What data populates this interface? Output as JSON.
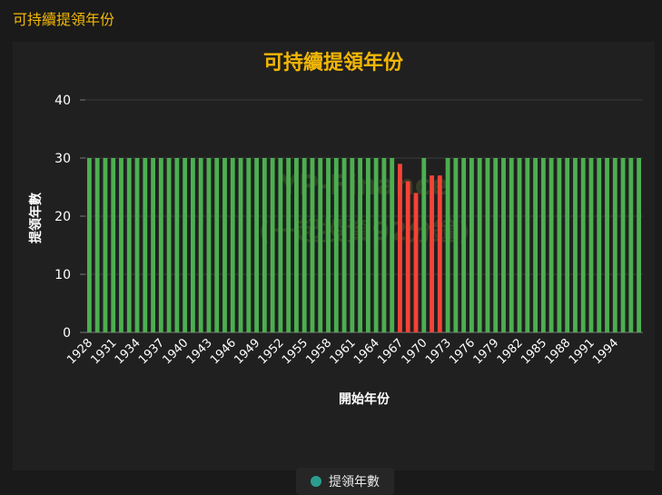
{
  "page": {
    "title": "可持續提領年份"
  },
  "chart_data": {
    "type": "bar",
    "title": "可持續提領年份",
    "xlabel": "開始年份",
    "ylabel": "提領年數",
    "ylim": [
      0,
      40
    ],
    "yticks": [
      0,
      10,
      20,
      30,
      40
    ],
    "grid": true,
    "legend_position": "bottom",
    "watermark": [
      "YP-Finance",
      "(一起投資92分鐘)"
    ],
    "x_start": 1928,
    "x_tick_labels": [
      "1928",
      "1931",
      "1934",
      "1937",
      "1940",
      "1943",
      "1946",
      "1949",
      "1952",
      "1955",
      "1958",
      "1961",
      "1964",
      "1967",
      "1970",
      "1973",
      "1976",
      "1979",
      "1982",
      "1985",
      "1988",
      "1991",
      "1994"
    ],
    "series": [
      {
        "name": "提領年數",
        "legend_color": "#2a9d8f",
        "bar_color": "#4caf50",
        "shortfall_color": "#f44336",
        "values": [
          30,
          30,
          30,
          30,
          30,
          30,
          30,
          30,
          30,
          30,
          30,
          30,
          30,
          30,
          30,
          30,
          30,
          30,
          30,
          30,
          30,
          30,
          30,
          30,
          30,
          30,
          30,
          30,
          30,
          30,
          30,
          30,
          30,
          30,
          30,
          30,
          30,
          30,
          30,
          29,
          26,
          24,
          30,
          27,
          27,
          30,
          30,
          30,
          30,
          30,
          30,
          30,
          30,
          30,
          30,
          30,
          30,
          30,
          30,
          30,
          30,
          30,
          30,
          30,
          30,
          30,
          30,
          30,
          30,
          30
        ]
      }
    ]
  }
}
